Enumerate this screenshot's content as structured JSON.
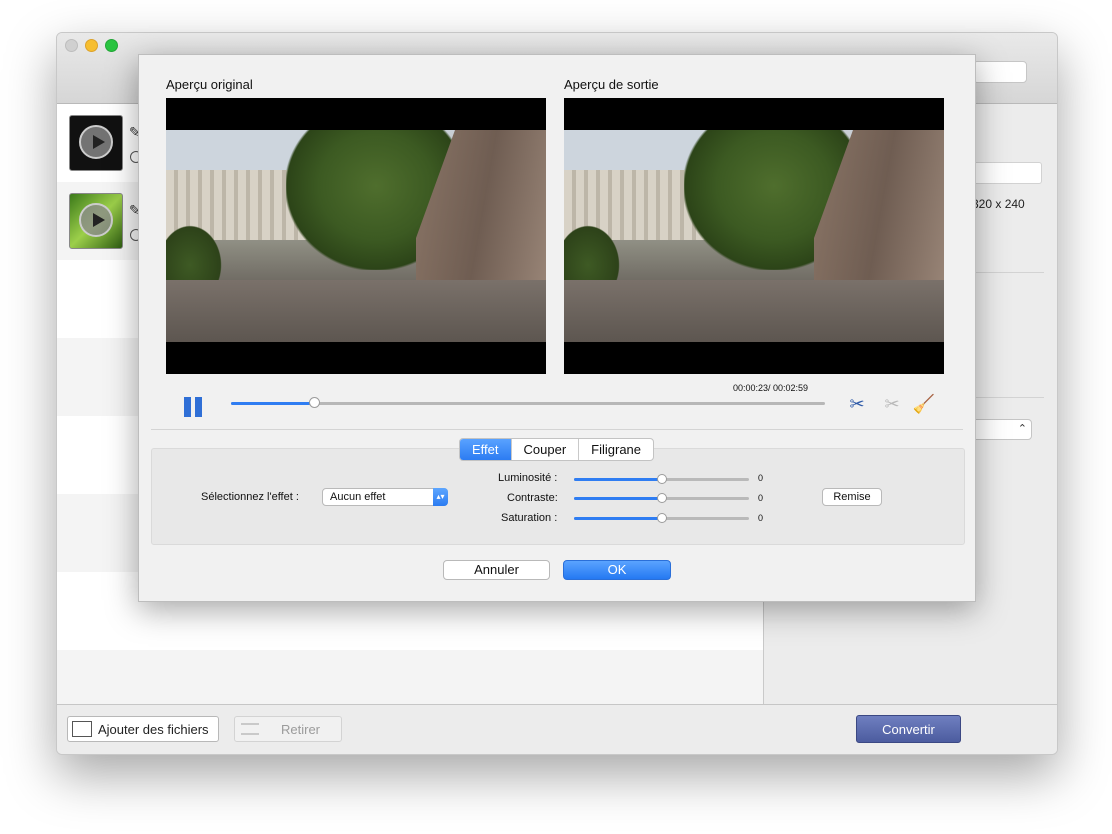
{
  "preview": {
    "original_label": "Aperçu original",
    "output_label": "Aperçu de sortie",
    "timecode": "00:00:23/ 00:02:59",
    "progress_fraction": 0.14
  },
  "tabs": [
    {
      "label": "Effet",
      "active": true
    },
    {
      "label": "Couper",
      "active": false
    },
    {
      "label": "Filigrane",
      "active": false
    }
  ],
  "effect": {
    "select_label": "Sélectionnez l'effet :",
    "select_value": "Aucun effet",
    "sliders": [
      {
        "label": "Luminosité :",
        "value": "0",
        "fraction": 0.5
      },
      {
        "label": "Contraste:",
        "value": "0",
        "fraction": 0.5
      },
      {
        "label": "Saturation :",
        "value": "0",
        "fraction": 0.5
      }
    ],
    "reset_label": "Remise"
  },
  "dialog": {
    "cancel_label": "Annuler",
    "ok_label": "OK"
  },
  "right_panel": {
    "resolution_fragment": "320 x 240"
  },
  "bottom": {
    "add_files_label": "Ajouter des fichiers",
    "remove_label": "Retirer",
    "convert_label": "Convertir"
  },
  "colors": {
    "accent": "#2f7df2",
    "convert": "#5565a8"
  }
}
